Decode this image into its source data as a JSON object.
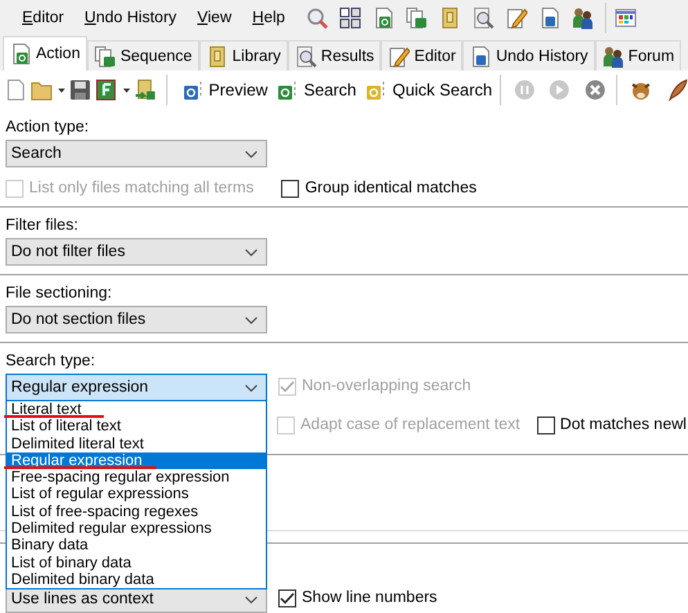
{
  "menu": [
    {
      "mnemonic": "E",
      "rest": "ditor"
    },
    {
      "mnemonic": "U",
      "rest": "ndo History"
    },
    {
      "mnemonic": "V",
      "rest": "iew"
    },
    {
      "mnemonic": "H",
      "rest": "elp"
    }
  ],
  "tabs": [
    {
      "label": "Action",
      "selected": true
    },
    {
      "label": "Sequence",
      "selected": false
    },
    {
      "label": "Library",
      "selected": false
    },
    {
      "label": "Results",
      "selected": false
    },
    {
      "label": "Editor",
      "selected": false
    },
    {
      "label": "Undo History",
      "selected": false
    },
    {
      "label": "Forum",
      "selected": false
    }
  ],
  "toolbar": {
    "buttons": [
      {
        "label": "Preview",
        "color": "#2a6ab8"
      },
      {
        "label": "Search",
        "color": "#2e8b3a"
      },
      {
        "label": "Quick Search",
        "color": "#d9b528"
      }
    ]
  },
  "action_type": {
    "label": "Action type:",
    "value": "Search"
  },
  "action_options": [
    {
      "label": "List only files matching all terms",
      "checked": false,
      "disabled": true
    },
    {
      "label": "Group identical matches",
      "checked": false,
      "disabled": false
    }
  ],
  "filter_files": {
    "label": "Filter files:",
    "value": "Do not filter files"
  },
  "file_sectioning": {
    "label": "File sectioning:",
    "value": "Do not section files"
  },
  "search_type": {
    "label": "Search type:",
    "value": "Regular expression",
    "expanded": true,
    "options": [
      {
        "label": "Literal text",
        "selected": false,
        "underlined": true
      },
      {
        "label": "List of literal text",
        "selected": false,
        "underlined": false
      },
      {
        "label": "Delimited literal text",
        "selected": false,
        "underlined": false
      },
      {
        "label": "Regular expression",
        "selected": true,
        "underlined": true
      },
      {
        "label": "Free-spacing regular expression",
        "selected": false,
        "underlined": false
      },
      {
        "label": "List of regular expressions",
        "selected": false,
        "underlined": false
      },
      {
        "label": "List of free-spacing regexes",
        "selected": false,
        "underlined": false
      },
      {
        "label": "Delimited regular expressions",
        "selected": false,
        "underlined": false
      },
      {
        "label": "Binary data",
        "selected": false,
        "underlined": false
      },
      {
        "label": "List of binary data",
        "selected": false,
        "underlined": false
      },
      {
        "label": "Delimited binary data",
        "selected": false,
        "underlined": false
      }
    ]
  },
  "search_options": [
    {
      "label": "Non-overlapping search",
      "checked": true,
      "disabled": true
    },
    {
      "label": "Adapt case of replacement text",
      "checked": false,
      "disabled": true
    },
    {
      "label": "Dot matches newl",
      "checked": false,
      "disabled": false
    }
  ],
  "context": {
    "value": "Use lines as context"
  },
  "show_line_numbers": {
    "label": "Show line numbers",
    "checked": true,
    "disabled": false
  }
}
